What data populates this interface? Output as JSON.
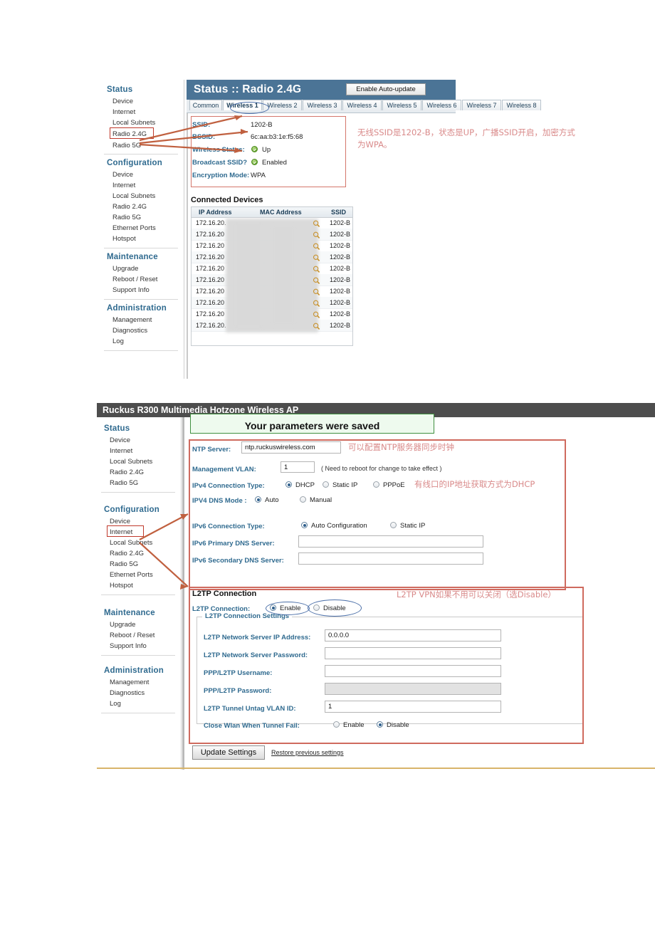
{
  "panel1": {
    "title": "Status :: Radio 2.4G",
    "auto_update_button": "Enable Auto-update",
    "tabs": [
      {
        "label": "Common",
        "active": false
      },
      {
        "label": "Wireless 1",
        "active": true
      },
      {
        "label": "Wireless 2",
        "active": false
      },
      {
        "label": "Wireless 3",
        "active": false
      },
      {
        "label": "Wireless 4",
        "active": false
      },
      {
        "label": "Wireless 5",
        "active": false
      },
      {
        "label": "Wireless 6",
        "active": false
      },
      {
        "label": "Wireless 7",
        "active": false
      },
      {
        "label": "Wireless 8",
        "active": false
      }
    ],
    "sidebar": {
      "groups": [
        {
          "head": "Status",
          "items": [
            "Device",
            "Internet",
            "Local Subnets",
            "Radio 2.4G",
            "Radio 5G"
          ]
        },
        {
          "head": "Configuration",
          "items": [
            "Device",
            "Internet",
            "Local Subnets",
            "Radio 2.4G",
            "Radio 5G",
            "Ethernet Ports",
            "Hotspot"
          ]
        },
        {
          "head": "Maintenance",
          "items": [
            "Upgrade",
            "Reboot / Reset",
            "Support Info"
          ]
        },
        {
          "head": "Administration",
          "items": [
            "Management",
            "Diagnostics",
            "Log"
          ]
        }
      ],
      "highlighted_item": "Radio 2.4G"
    },
    "info": {
      "ssid_label": "SSID:",
      "ssid_value": "1202-B",
      "bssid_label": "BSSID:",
      "bssid_value": "6c:aa:b3:1e:f5:68",
      "wireless_status_label": "Wireless Status:",
      "wireless_status_value": "Up",
      "broadcast_label": "Broadcast SSID?",
      "broadcast_value": "Enabled",
      "encryption_label": "Encryption Mode:",
      "encryption_value": "WPA"
    },
    "connected_devices": {
      "title": "Connected Devices",
      "columns": [
        "IP Address",
        "MAC Address",
        "SSID"
      ],
      "rows": [
        {
          "ip": "172.16.20.",
          "mac": "",
          "ssid": "1202-B"
        },
        {
          "ip": "172.16.20",
          "mac": "",
          "ssid": "1202-B"
        },
        {
          "ip": "172.16.20",
          "mac": "",
          "ssid": "1202-B"
        },
        {
          "ip": "172.16.20",
          "mac": "",
          "ssid": "1202-B"
        },
        {
          "ip": "172.16.20",
          "mac": "",
          "ssid": "1202-B"
        },
        {
          "ip": "172.16.20",
          "mac": "",
          "ssid": "1202-B"
        },
        {
          "ip": "172.16.20",
          "mac": "",
          "ssid": "1202-B"
        },
        {
          "ip": "172.16.20",
          "mac": "",
          "ssid": "1202-B"
        },
        {
          "ip": "172.16.20",
          "mac": "",
          "ssid": "1202-B"
        },
        {
          "ip": "172.16.20.",
          "mac": "",
          "ssid": "1202-B"
        }
      ]
    },
    "annotation": "无线SSID是1202-B，状态是UP，广播SSID开启，加密方式\n为WPA。"
  },
  "panel2": {
    "title": "Ruckus R300 Multimedia Hotzone Wireless AP",
    "saved_banner": "Your parameters were saved",
    "sidebar": {
      "groups": [
        {
          "head": "Status",
          "items": [
            "Device",
            "Internet",
            "Local Subnets",
            "Radio 2.4G",
            "Radio 5G"
          ]
        },
        {
          "head": "Configuration",
          "items": [
            "Device",
            "Internet",
            "Local Subnets",
            "Radio 2.4G",
            "Radio 5G",
            "Ethernet Ports",
            "Hotspot"
          ]
        },
        {
          "head": "Maintenance",
          "items": [
            "Upgrade",
            "Reboot / Reset",
            "Support Info"
          ]
        },
        {
          "head": "Administration",
          "items": [
            "Management",
            "Diagnostics",
            "Log"
          ]
        }
      ],
      "highlighted_item": "Internet"
    },
    "form": {
      "ntp_label": "NTP Server:",
      "ntp_value": "ntp.ruckuswireless.com",
      "vlan_label": "Management VLAN:",
      "vlan_value": "1",
      "vlan_note": "( Need to reboot for change to take effect )",
      "ipv4_conn_label": "IPv4 Connection Type:",
      "ipv4_conn_options": [
        {
          "label": "DHCP",
          "selected": true
        },
        {
          "label": "Static IP",
          "selected": false
        },
        {
          "label": "PPPoE",
          "selected": false
        }
      ],
      "ipv4_dns_label": "IPV4 DNS Mode :",
      "ipv4_dns_options": [
        {
          "label": "Auto",
          "selected": true
        },
        {
          "label": "Manual",
          "selected": false
        }
      ],
      "ipv6_conn_label": "IPv6 Connection Type:",
      "ipv6_conn_options": [
        {
          "label": "Auto Configuration",
          "selected": true
        },
        {
          "label": "Static IP",
          "selected": false
        }
      ],
      "ipv6_primary_label": "IPv6 Primary DNS Server:",
      "ipv6_primary_value": "",
      "ipv6_secondary_label": "IPv6 Secondary DNS Server:",
      "ipv6_secondary_value": ""
    },
    "l2tp": {
      "section_title": "L2TP Connection",
      "conn_label": "L2TP Connection:",
      "conn_options": [
        {
          "label": "Enable",
          "selected": true
        },
        {
          "label": "Disable",
          "selected": false
        }
      ],
      "settings_legend": "L2TP Connection Settings",
      "server_ip_label": "L2TP Network Server IP Address:",
      "server_ip_value": "0.0.0.0",
      "server_pw_label": "L2TP Network Server Password:",
      "server_pw_value": "",
      "username_label": "PPP/L2TP Username:",
      "username_value": "",
      "password_label": "PPP/L2TP Password:",
      "password_value": "",
      "vlan_label": "L2TP Tunnel Untag VLAN ID:",
      "vlan_value": "1",
      "close_wlan_label": "Close Wlan When Tunnel Fail:",
      "close_wlan_options": [
        {
          "label": "Enable",
          "selected": false
        },
        {
          "label": "Disable",
          "selected": true
        }
      ]
    },
    "footer": {
      "update_button": "Update Settings",
      "restore_link": "Restore previous settings"
    },
    "annotations": {
      "ntp": "可以配置NTP服务器同步时钟",
      "dhcp": "有线口的IP地址获取方式为DHCP",
      "l2tp": "L2TP VPN如果不用可以关闭（选Disable）"
    }
  },
  "colors": {
    "header_blue": "#4b7496",
    "header_dark": "#4d4d4d",
    "accent_label": "#2f6a8f",
    "annotation_red": "#d98a8a",
    "box_red": "#d4766b",
    "ellipse_blue": "#4b6fa8",
    "ok_green": "#6aa832",
    "gold_rule": "#d8b46a"
  }
}
